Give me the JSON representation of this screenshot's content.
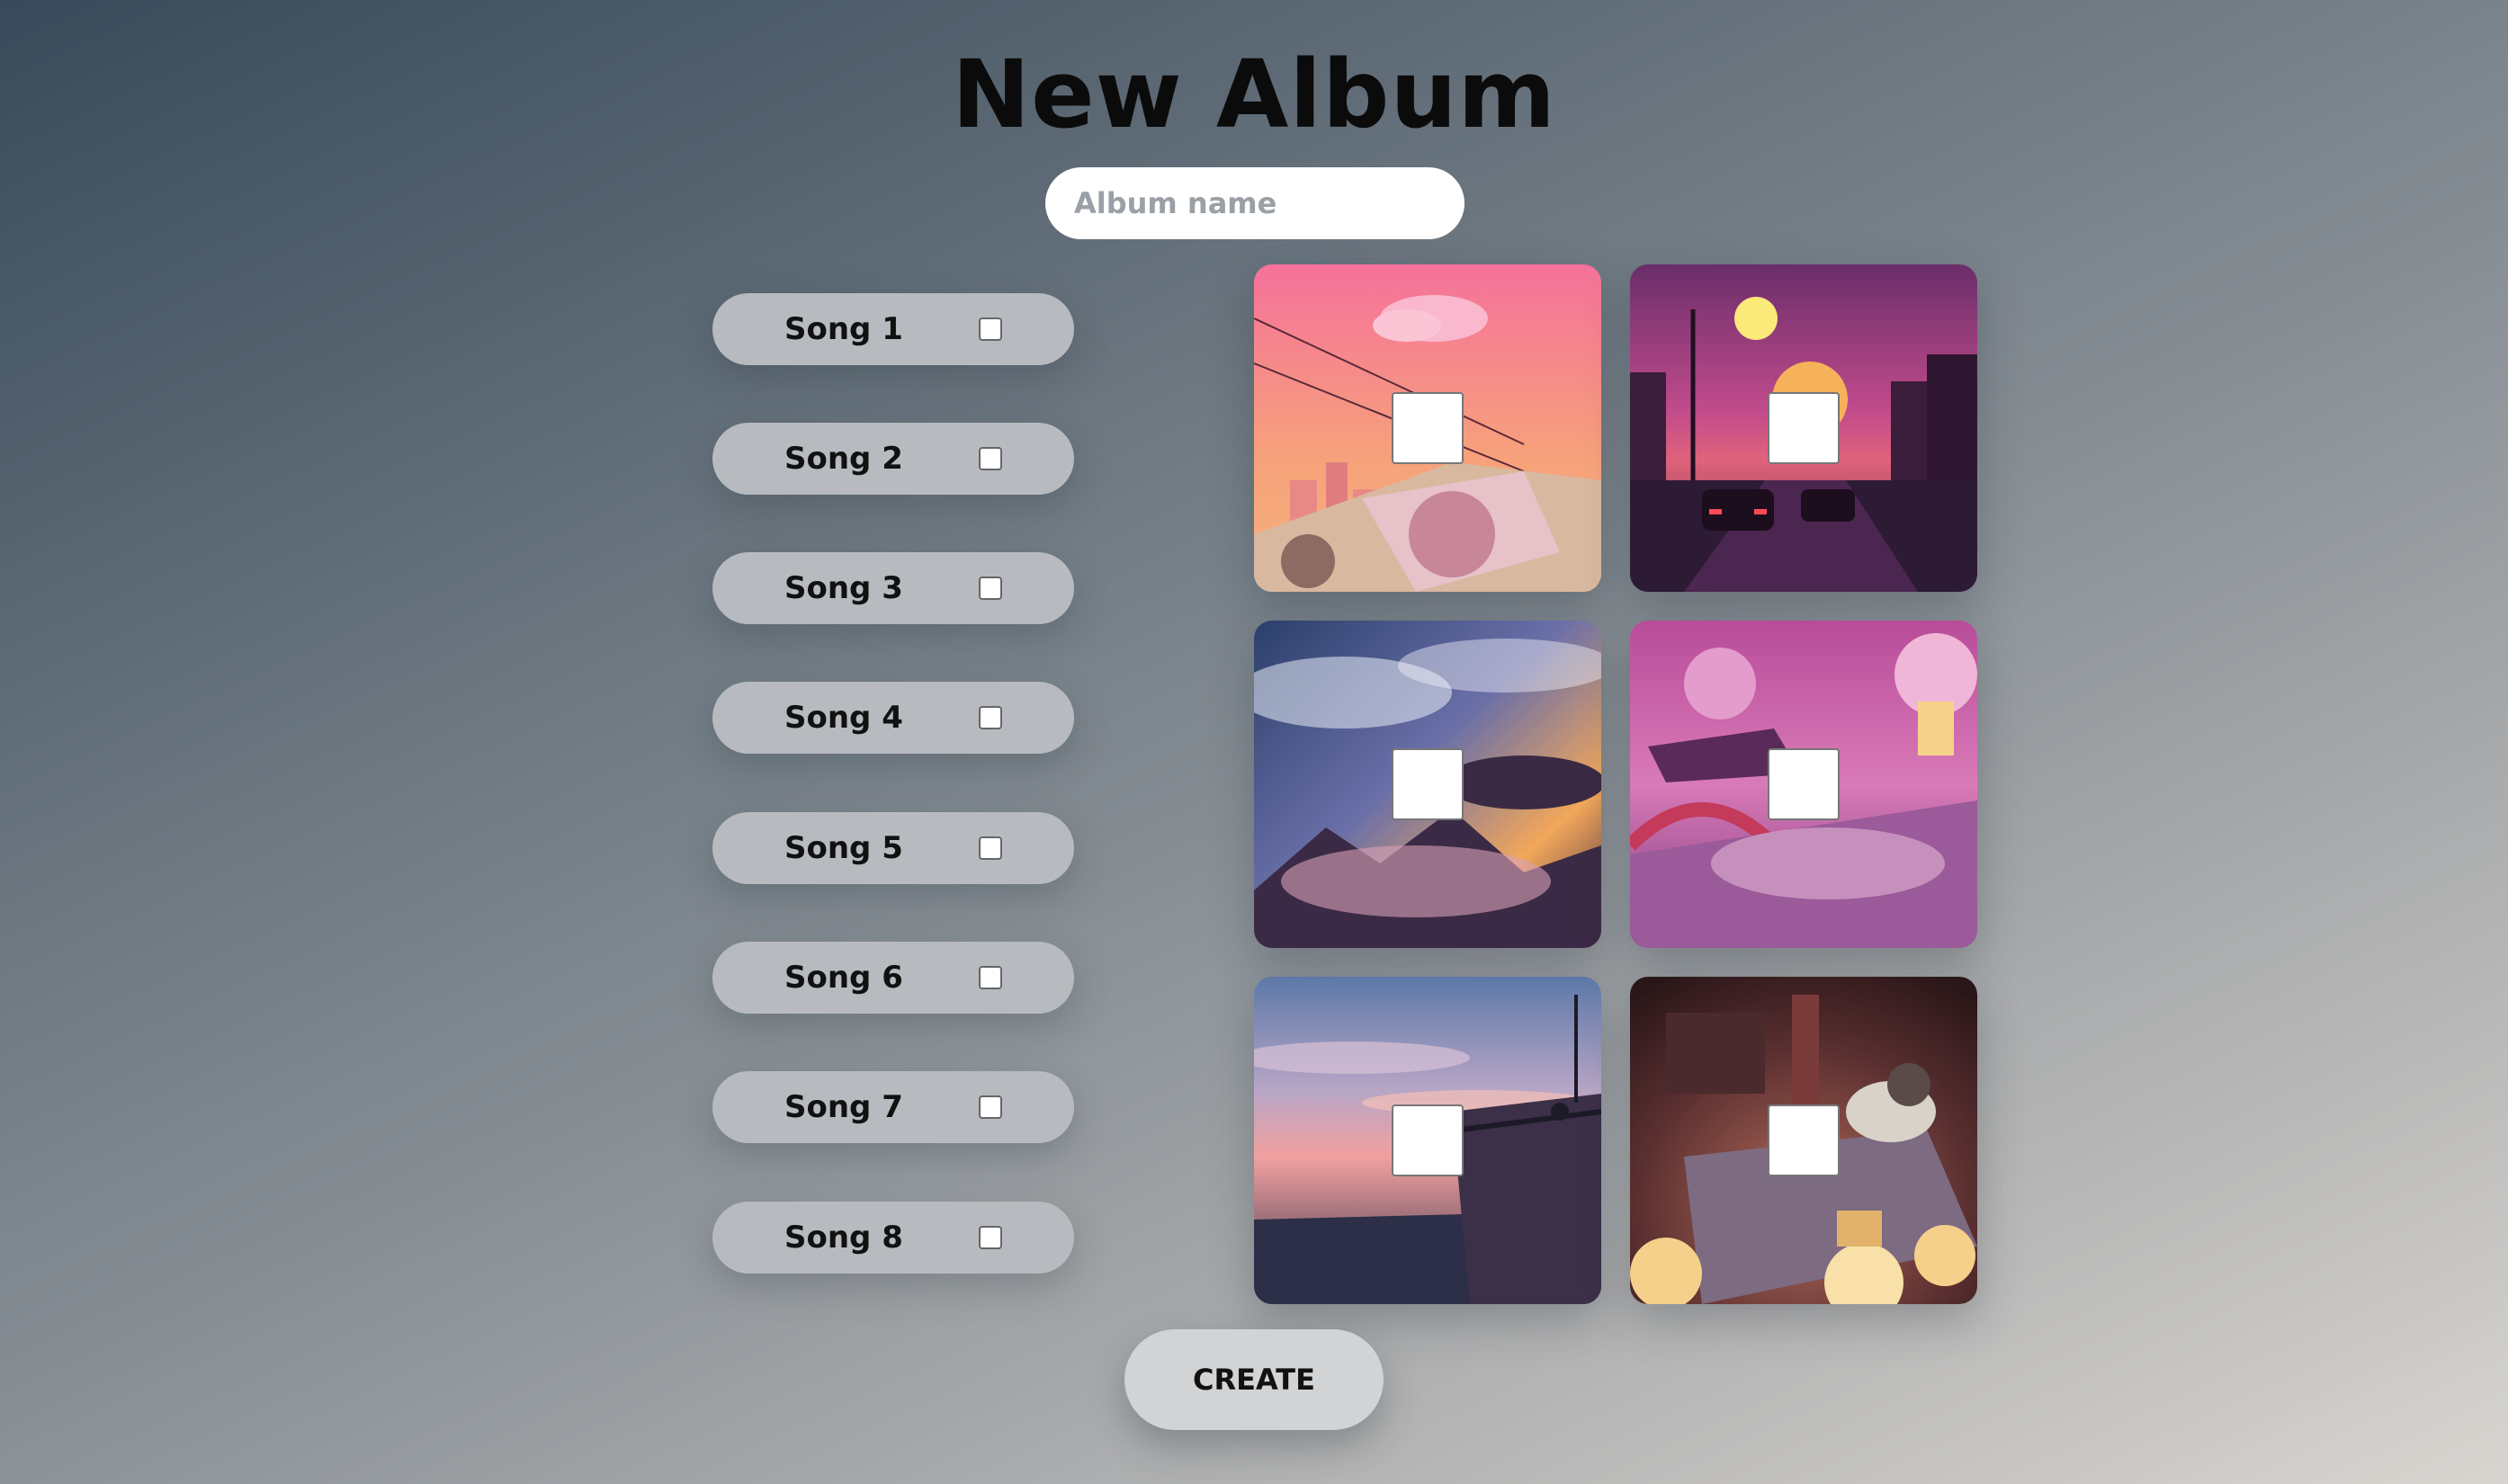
{
  "header": {
    "title": "New Album"
  },
  "album_name": {
    "value": "",
    "placeholder": "Album name"
  },
  "songs": [
    {
      "label": "Song 1",
      "checked": false
    },
    {
      "label": "Song 2",
      "checked": false
    },
    {
      "label": "Song 3",
      "checked": false
    },
    {
      "label": "Song 4",
      "checked": false
    },
    {
      "label": "Song 5",
      "checked": false
    },
    {
      "label": "Song 6",
      "checked": false
    },
    {
      "label": "Song 7",
      "checked": false
    },
    {
      "label": "Song 8",
      "checked": false
    }
  ],
  "covers": [
    {
      "name": "cover-pink-city-road",
      "checked": false
    },
    {
      "name": "cover-purple-highway-sunset",
      "checked": false
    },
    {
      "name": "cover-sky-whale-clouds",
      "checked": false
    },
    {
      "name": "cover-pink-garden-bridge",
      "checked": false
    },
    {
      "name": "cover-rooftop-dusk",
      "checked": false
    },
    {
      "name": "cover-cozy-room-raccoon",
      "checked": false
    }
  ],
  "actions": {
    "create_label": "CREATE"
  },
  "colors": {
    "background_top": "#384a5a",
    "background_bottom": "#d8d5d0",
    "song_pill": "#b7bbbf",
    "create_button": "#d1d3d5"
  }
}
